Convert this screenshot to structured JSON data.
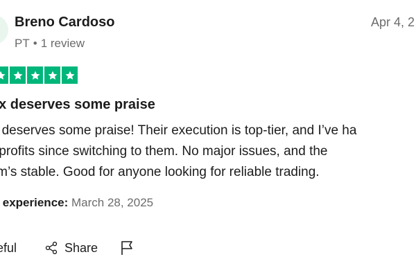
{
  "reviewer": {
    "name": "Breno Cardoso",
    "country": "PT",
    "separator": "•",
    "review_count": "1 review"
  },
  "review": {
    "date": "Apr 4, 2",
    "rating": 5,
    "star_color": "#00b67a",
    "title": "ex deserves some praise",
    "body_lines": [
      "lex deserves some praise! Their execution is top-tier, and I’ve ha",
      "dy profits since switching to them. No major issues, and the",
      "form’s stable. Good for anyone looking for reliable trading."
    ],
    "experience_label": "of experience:",
    "experience_date": "March 28, 2025"
  },
  "actions": {
    "useful_label": "seful",
    "share_label": "Share",
    "report_icon": "flag-icon",
    "share_icon": "share-icon"
  }
}
